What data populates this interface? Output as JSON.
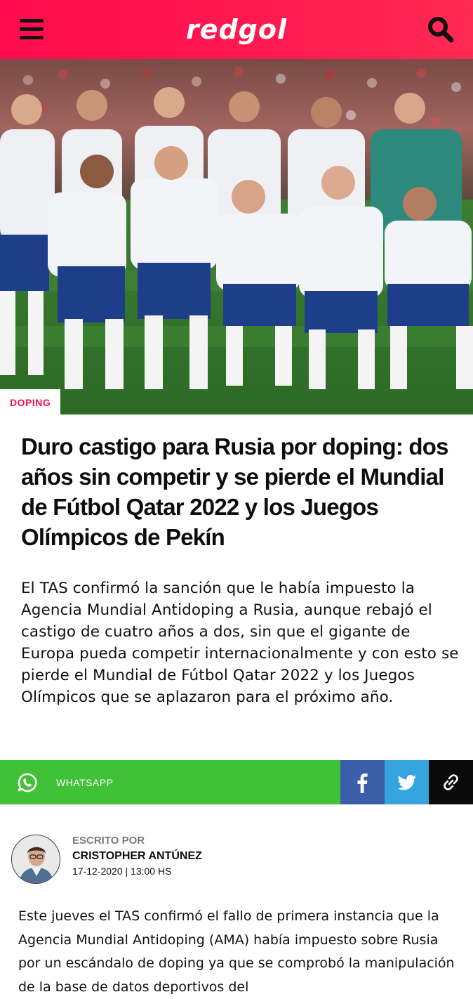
{
  "header": {
    "logo_text": "redgol",
    "brand_color": "#ff0b4e",
    "menu_icon": "hamburger-menu-icon",
    "search_icon": "search-icon"
  },
  "article": {
    "hero_image": "Russia national football team posing for group photo",
    "category": "DOPING",
    "title": "Duro castigo para Rusia por doping: dos años sin competir y se pierde el Mundial de Fútbol Qatar 2022 y los Juegos Olímpicos de Pekín",
    "lead": "El TAS confirmó la sanción que le había impuesto la Agencia Mundial Antidoping a Rusia, aunque rebajó el castigo de cuatro años a dos, sin que el gigante de Europa pueda competir internacionalmente y con esto se pierde el Mundial de Fútbol Qatar 2022 y los Juegos Olímpicos que se aplazaron para el próximo año.",
    "body": "Este jueves el TAS confirmó el fallo de primera instancia que la  Agencia Mundial Antidoping (AMA) había impuesto sobre Rusia por un escándalo de doping ya que se comprobó la manipulación de  la base de datos deportivos del"
  },
  "share": {
    "whatsapp_label": "WHATSAPP",
    "whatsapp_color": "#40c137",
    "facebook_color": "#3a5ea8",
    "twitter_color": "#36a4e0",
    "link_color": "#0a0a0a",
    "icons": [
      "whatsapp-icon",
      "facebook-icon",
      "twitter-icon",
      "link-icon"
    ]
  },
  "author": {
    "written_by_label": "ESCRITO POR",
    "name": "CRISTOPHER ANTÚNEZ",
    "date": "17-12-2020 | 13:00 HS"
  }
}
